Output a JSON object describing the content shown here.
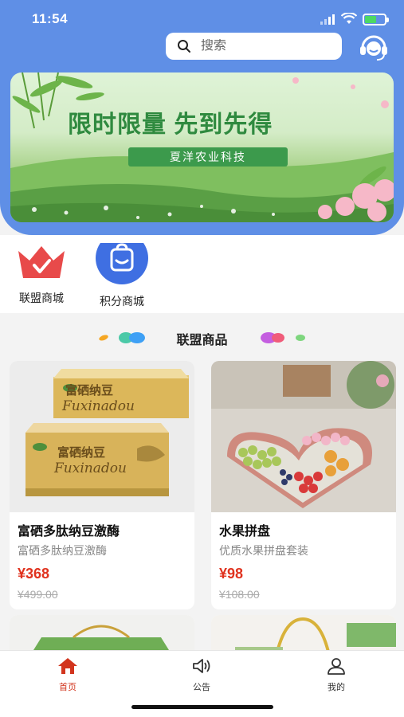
{
  "status_bar": {
    "time": "11:54"
  },
  "search": {
    "placeholder": "搜索",
    "icon": "search-icon"
  },
  "header": {
    "support_icon": "customer-service-icon",
    "accent_color": "#5f8fe6"
  },
  "banner": {
    "headline": "限时限量  先到先得",
    "subtitle": "夏洋农业科技"
  },
  "categories": [
    {
      "label": "联盟商城",
      "icon": "crown-icon",
      "color": "#e84a4a"
    },
    {
      "label": "积分商城",
      "icon": "shopping-bag-icon",
      "color": "#3f6fe2"
    }
  ],
  "section": {
    "title": "联盟商品"
  },
  "products": [
    {
      "name": "富硒多肽纳豆激酶",
      "desc": "富硒多肽纳豆激酶",
      "price": "¥368",
      "orig_price": "¥499.00",
      "image_text": [
        "富硒纳豆",
        "Fuxinadou"
      ]
    },
    {
      "name": "水果拼盘",
      "desc": "优质水果拼盘套装",
      "price": "¥98",
      "orig_price": "¥108.00"
    }
  ],
  "tabbar": {
    "items": [
      {
        "label": "首页",
        "icon": "home-icon",
        "active": true
      },
      {
        "label": "公告",
        "icon": "speaker-icon",
        "active": false
      },
      {
        "label": "我的",
        "icon": "user-icon",
        "active": false
      }
    ],
    "active_color": "#d2351e"
  }
}
